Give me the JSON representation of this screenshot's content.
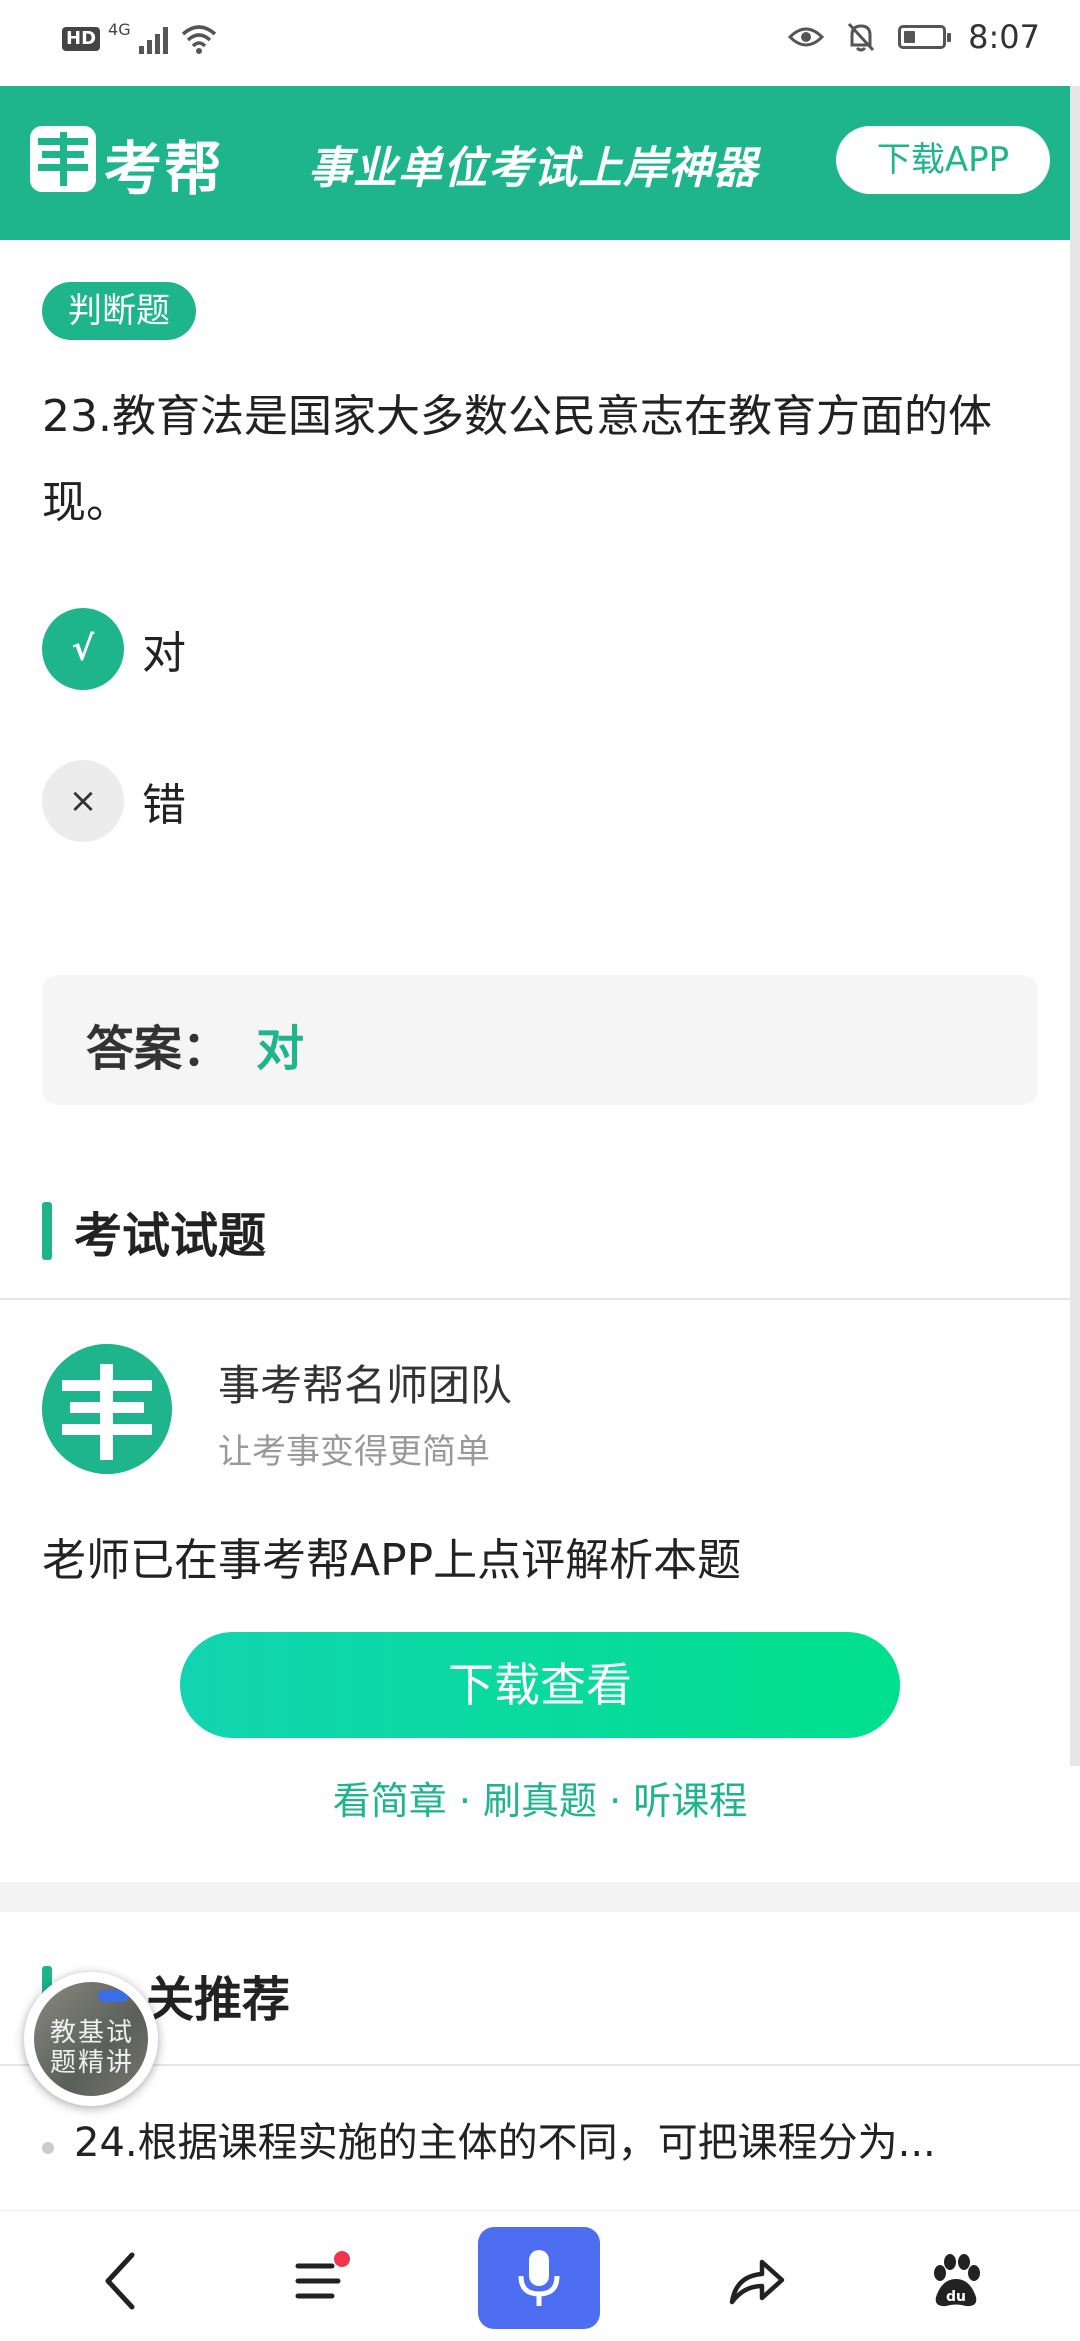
{
  "status_bar": {
    "hd_label": "HD",
    "network_label": "4G",
    "time": "8:07",
    "battery_level": 0.3,
    "icons": [
      "signal-icon",
      "wifi-icon",
      "eye-icon",
      "bell-off-icon",
      "battery-icon"
    ]
  },
  "banner": {
    "logo_text": "考帮",
    "slogan": "事业单位考试上岸神器",
    "download_label": "下载APP",
    "color": "#1fb58c"
  },
  "question": {
    "type_tag": "判断题",
    "text": "23.教育法是国家大多数公民意志在教育方面的体现。",
    "options": [
      {
        "symbol": "√",
        "label": "对",
        "selected": true
      },
      {
        "symbol": "×",
        "label": "错",
        "selected": false
      }
    ]
  },
  "answer": {
    "label": "答案：",
    "value": "对"
  },
  "exam_section": {
    "title": "考试试题"
  },
  "teacher": {
    "name": "事考帮名师团队",
    "subtitle": "让考事变得更简单",
    "promo": "老师已在事考帮APP上点评解析本题",
    "cta_label": "下载查看",
    "links": "看简章 · 刷真题 · 听课程"
  },
  "related": {
    "title": "关推荐",
    "items": [
      "24.根据课程实施的主体的不同，可把课程分为..."
    ]
  },
  "floating_thumb": {
    "text": "教基试题精讲"
  },
  "bottom_nav": {
    "items": [
      "back-icon",
      "menu-icon",
      "microphone-icon",
      "share-icon",
      "baidu-paw-icon"
    ],
    "accent": "#4e6ef2"
  }
}
